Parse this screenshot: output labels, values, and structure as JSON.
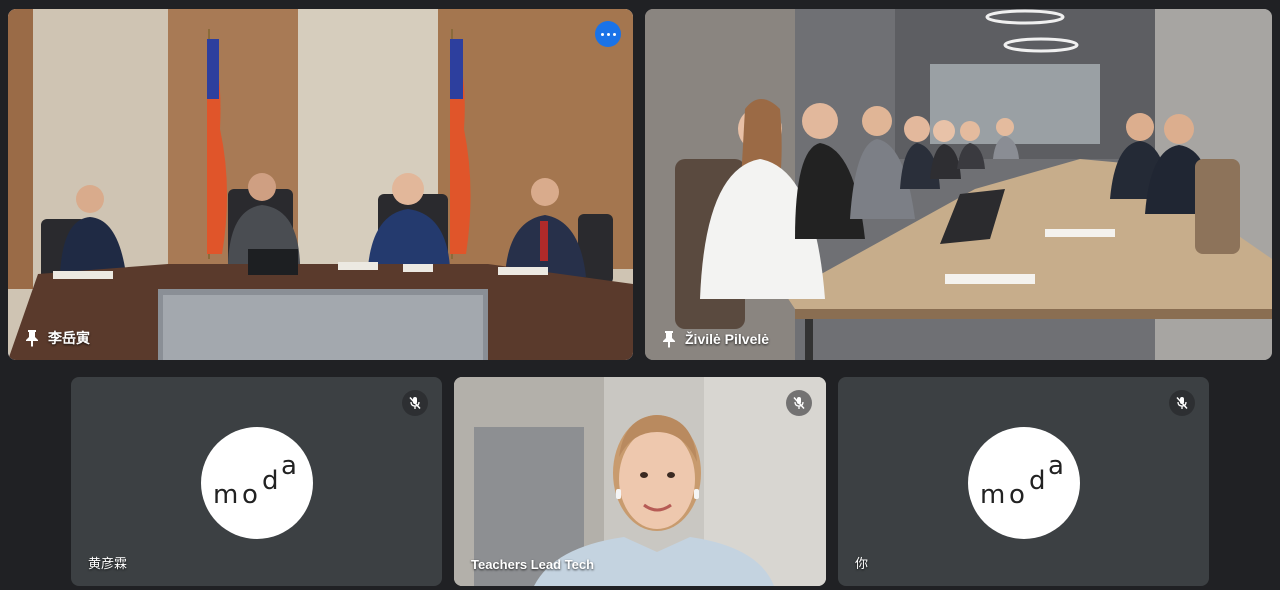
{
  "participants": [
    {
      "name": "李岳寅",
      "pinned": true,
      "active": true,
      "has_video": true,
      "muted": false,
      "options_button": true
    },
    {
      "name": "Živilė Pilvelė",
      "pinned": true,
      "active": false,
      "has_video": true,
      "muted": false
    },
    {
      "name": "黄彦霖",
      "pinned": false,
      "active": false,
      "has_video": false,
      "muted": true,
      "avatar": "moda"
    },
    {
      "name": "Teachers Lead Tech",
      "pinned": false,
      "active": false,
      "has_video": true,
      "muted": true
    },
    {
      "name": "你",
      "pinned": false,
      "active": false,
      "has_video": false,
      "muted": true,
      "avatar": "moda"
    }
  ],
  "avatar_letters": {
    "m": "m",
    "o1": "o",
    "d": "d",
    "a": "a"
  },
  "icons": {
    "pin": "pin-icon",
    "mute": "mic-off-icon",
    "more": "more-options-icon"
  },
  "colors": {
    "background": "#202124",
    "tile": "#3c4043",
    "active_outline": "#8ab4f8",
    "options_button": "#1a73e8"
  }
}
